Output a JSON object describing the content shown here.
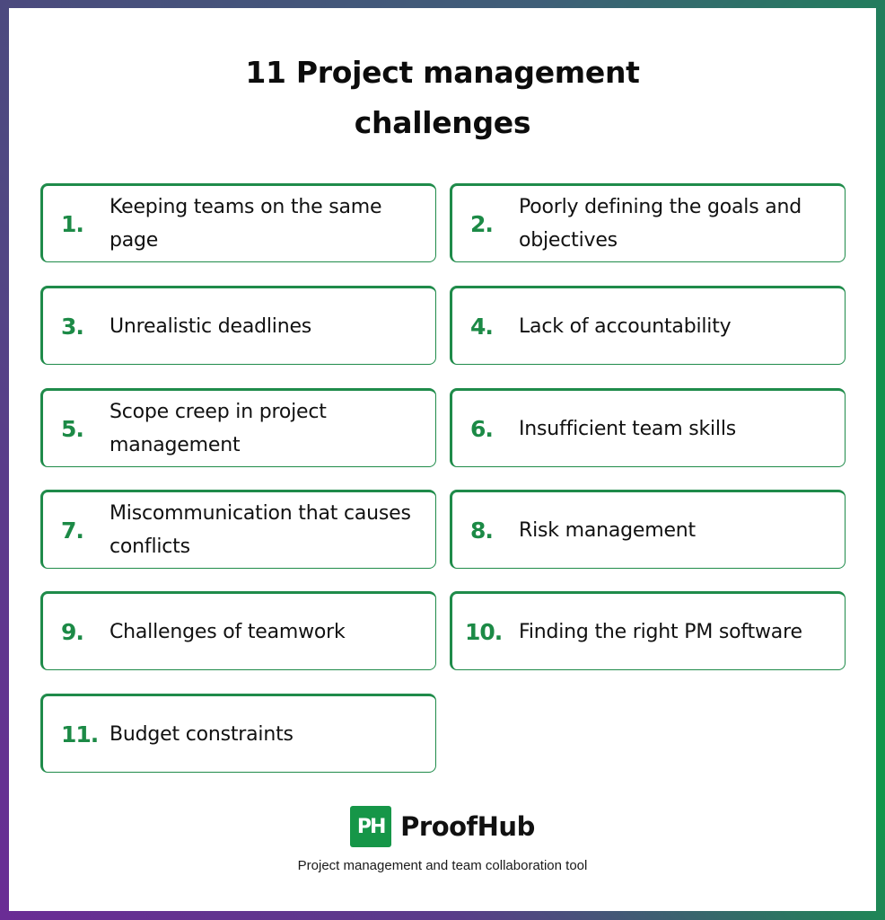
{
  "title": {
    "line1": "11 Project management",
    "line2": "challenges"
  },
  "items": [
    {
      "number": "1.",
      "text": "Keeping teams on the same page"
    },
    {
      "number": "2.",
      "text": "Poorly defining the goals and objectives"
    },
    {
      "number": "3.",
      "text": "Unrealistic deadlines"
    },
    {
      "number": "4.",
      "text": "Lack of accountability"
    },
    {
      "number": "5.",
      "text": "Scope creep in project management"
    },
    {
      "number": "6.",
      "text": "Insufficient team skills"
    },
    {
      "number": "7.",
      "text": "Miscommunication that causes conflicts"
    },
    {
      "number": "8.",
      "text": "Risk management"
    },
    {
      "number": "9.",
      "text": "Challenges of teamwork"
    },
    {
      "number": "10.",
      "text": "Finding the right PM software"
    },
    {
      "number": "11.",
      "text": "Budget constraints"
    }
  ],
  "brand": {
    "logo_text": "PH",
    "name": "ProofHub",
    "tagline": "Project management and team collaboration tool"
  },
  "colors": {
    "accent_green": "#1c8a46",
    "logo_green": "#169648",
    "frame_top_left": "#4a4b7d",
    "frame_top_right": "#11984a",
    "frame_bottom_left": "#6a2c95",
    "frame_bottom_right": "#1f7a5a"
  }
}
